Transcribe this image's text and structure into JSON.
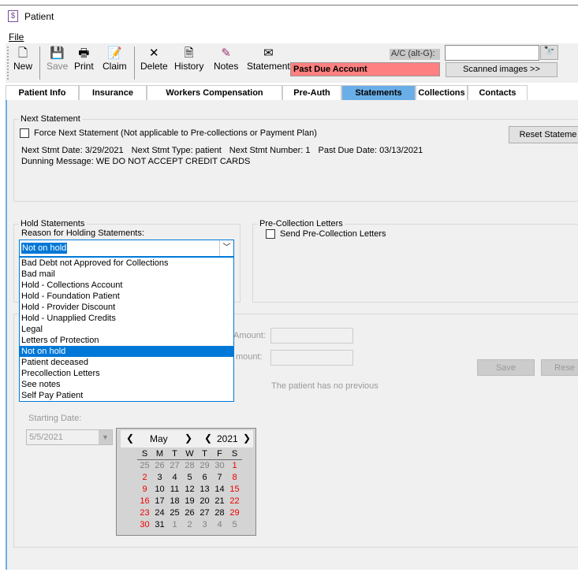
{
  "window": {
    "title": "Patient"
  },
  "menu": {
    "file": "File"
  },
  "toolbar": {
    "new": "New",
    "save": "Save",
    "print": "Print",
    "claim": "Claim",
    "delete": "Delete",
    "history": "History",
    "notes": "Notes",
    "statement": "Statement",
    "alert": "Past Due Account",
    "ac_label": "A/C (alt-G):",
    "ac_value": "",
    "scanned": "Scanned images >>",
    "alert_color": "#ff8080"
  },
  "tabs": [
    "Patient Info",
    "Insurance",
    "Workers Compensation",
    "Pre-Auth",
    "Statements",
    "Collections",
    "Contacts"
  ],
  "next_statement": {
    "label": "Next Statement",
    "force": "Force Next Statement (Not applicable to Pre-collections or Payment Plan)",
    "reset": "Reset Stateme",
    "date": "Next Stmt Date: 3/29/2021",
    "type": "Next Stmt Type: patient",
    "number": "Next Stmt Number: 1",
    "past_due": "Past Due Date: 03/13/2021",
    "dunning": "Dunning Message: WE DO NOT ACCEPT CREDIT CARDS"
  },
  "hold": {
    "label": "Hold Statements",
    "reason_label": "Reason for Holding Statements:",
    "selected": "Not on hold",
    "options": [
      "Bad Debt not Approved for Collections",
      "Bad mail",
      "Hold - Collections Account",
      "Hold - Foundation Patient",
      "Hold - Provider Discount",
      "Hold - Unapplied Credits",
      "Legal",
      "Letters of Protection",
      "Not on hold",
      "Patient deceased",
      "Precollection Letters",
      "See notes",
      "Self Pay Patient"
    ]
  },
  "precollection": {
    "label": "Pre-Collection Letters",
    "send": "Send Pre-Collection Letters"
  },
  "plan": {
    "amount1": "Amount:",
    "amount2": "mount:",
    "save": "Save",
    "reset": "Rese",
    "note": "The patient has no previous",
    "start_label": "Starting Date:",
    "start_value": "5/5/2021"
  },
  "calendar": {
    "month": "May",
    "year": "2021",
    "dow": [
      "S",
      "M",
      "T",
      "W",
      "T",
      "F",
      "S"
    ],
    "weeks": [
      [
        "25",
        "26",
        "27",
        "28",
        "29",
        "30",
        "1"
      ],
      [
        "2",
        "3",
        "4",
        "5",
        "6",
        "7",
        "8"
      ],
      [
        "9",
        "10",
        "11",
        "12",
        "13",
        "14",
        "15"
      ],
      [
        "16",
        "17",
        "18",
        "19",
        "20",
        "21",
        "22"
      ],
      [
        "23",
        "24",
        "25",
        "26",
        "27",
        "28",
        "29"
      ],
      [
        "30",
        "31",
        "1",
        "2",
        "3",
        "4",
        "5"
      ]
    ]
  }
}
